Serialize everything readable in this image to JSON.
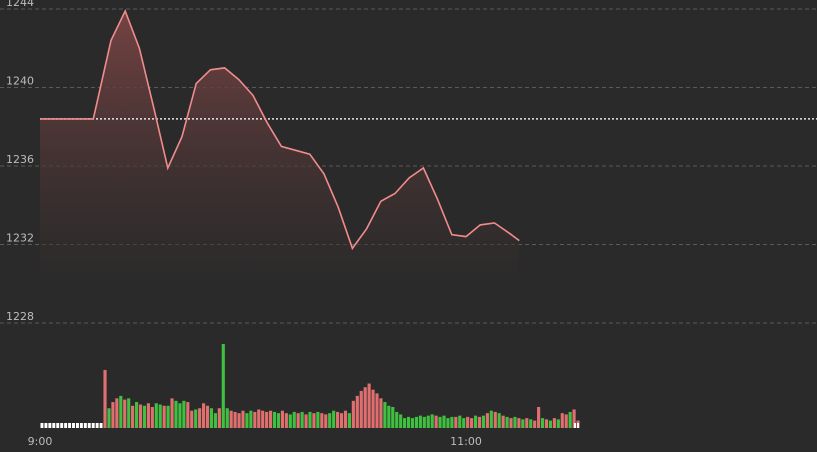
{
  "chart_data": {
    "type": "line",
    "title": "",
    "ylim": [
      1228,
      1244
    ],
    "yticks": [
      "1244",
      "1240",
      "1236",
      "1232",
      "1228"
    ],
    "xtick_labels": [
      "9:00",
      "11:00"
    ],
    "grid": true,
    "reference_line": 1238.4,
    "colors": {
      "line": "#f08c8c",
      "up": "#e07070",
      "down": "#40c040",
      "grid": "#5a5a5a",
      "reference": "#e8e8e8"
    },
    "price_series": [
      [
        "9:00",
        1238.4
      ],
      [
        "9:15",
        1238.4
      ],
      [
        "9:20",
        1242.4
      ],
      [
        "9:24",
        1243.9
      ],
      [
        "9:28",
        1242.0
      ],
      [
        "9:32",
        1239.0
      ],
      [
        "9:36",
        1235.9
      ],
      [
        "9:40",
        1237.5
      ],
      [
        "9:44",
        1240.2
      ],
      [
        "9:48",
        1240.9
      ],
      [
        "9:52",
        1241.0
      ],
      [
        "9:56",
        1240.4
      ],
      [
        "10:00",
        1239.6
      ],
      [
        "10:04",
        1238.2
      ],
      [
        "10:08",
        1237.0
      ],
      [
        "10:12",
        1236.8
      ],
      [
        "10:16",
        1236.6
      ],
      [
        "10:20",
        1235.6
      ],
      [
        "10:24",
        1233.9
      ],
      [
        "10:28",
        1231.8
      ],
      [
        "10:32",
        1232.8
      ],
      [
        "10:36",
        1234.2
      ],
      [
        "10:40",
        1234.6
      ],
      [
        "10:44",
        1235.4
      ],
      [
        "10:48",
        1235.9
      ],
      [
        "10:52",
        1234.3
      ],
      [
        "10:56",
        1232.5
      ],
      [
        "11:00",
        1232.4
      ],
      [
        "11:04",
        1233.0
      ],
      [
        "11:08",
        1233.1
      ],
      [
        "11:12",
        1232.6
      ],
      [
        "11:15",
        1232.2
      ]
    ],
    "volume_series": [
      [
        0,
        0
      ],
      [
        0,
        0
      ],
      [
        0,
        0
      ],
      [
        0,
        0
      ],
      [
        0,
        0
      ],
      [
        0,
        0
      ],
      [
        0,
        0
      ],
      [
        0,
        0
      ],
      [
        0,
        0
      ],
      [
        0,
        0
      ],
      [
        0,
        0
      ],
      [
        0,
        0
      ],
      [
        0,
        0
      ],
      [
        0,
        0
      ],
      [
        0,
        0
      ],
      [
        0,
        0
      ],
      [
        47,
        0
      ],
      [
        16,
        1
      ],
      [
        21,
        0
      ],
      [
        24,
        0
      ],
      [
        26,
        1
      ],
      [
        23,
        0
      ],
      [
        24,
        1
      ],
      [
        18,
        0
      ],
      [
        21,
        1
      ],
      [
        19,
        0
      ],
      [
        18,
        1
      ],
      [
        20,
        0
      ],
      [
        17,
        0
      ],
      [
        20,
        1
      ],
      [
        19,
        1
      ],
      [
        18,
        0
      ],
      [
        18,
        1
      ],
      [
        24,
        0
      ],
      [
        22,
        1
      ],
      [
        20,
        1
      ],
      [
        22,
        1
      ],
      [
        21,
        0
      ],
      [
        14,
        0
      ],
      [
        15,
        1
      ],
      [
        16,
        0
      ],
      [
        20,
        0
      ],
      [
        18,
        0
      ],
      [
        16,
        1
      ],
      [
        12,
        1
      ],
      [
        16,
        0
      ],
      [
        68,
        1
      ],
      [
        16,
        1
      ],
      [
        14,
        0
      ],
      [
        13,
        0
      ],
      [
        12,
        0
      ],
      [
        14,
        0
      ],
      [
        12,
        1
      ],
      [
        14,
        1
      ],
      [
        13,
        0
      ],
      [
        15,
        0
      ],
      [
        14,
        0
      ],
      [
        13,
        0
      ],
      [
        14,
        0
      ],
      [
        13,
        1
      ],
      [
        12,
        1
      ],
      [
        14,
        0
      ],
      [
        12,
        0
      ],
      [
        11,
        1
      ],
      [
        13,
        1
      ],
      [
        12,
        0
      ],
      [
        13,
        1
      ],
      [
        11,
        0
      ],
      [
        13,
        1
      ],
      [
        12,
        0
      ],
      [
        13,
        1
      ],
      [
        12,
        0
      ],
      [
        11,
        0
      ],
      [
        12,
        1
      ],
      [
        14,
        1
      ],
      [
        13,
        0
      ],
      [
        12,
        0
      ],
      [
        14,
        0
      ],
      [
        12,
        1
      ],
      [
        22,
        0
      ],
      [
        26,
        0
      ],
      [
        30,
        0
      ],
      [
        33,
        0
      ],
      [
        36,
        0
      ],
      [
        31,
        0
      ],
      [
        28,
        0
      ],
      [
        24,
        0
      ],
      [
        21,
        1
      ],
      [
        18,
        1
      ],
      [
        17,
        1
      ],
      [
        13,
        1
      ],
      [
        11,
        1
      ],
      [
        8,
        1
      ],
      [
        9,
        1
      ],
      [
        8,
        1
      ],
      [
        9,
        1
      ],
      [
        10,
        1
      ],
      [
        9,
        1
      ],
      [
        10,
        1
      ],
      [
        11,
        1
      ],
      [
        10,
        0
      ],
      [
        9,
        1
      ],
      [
        10,
        1
      ],
      [
        8,
        1
      ],
      [
        9,
        1
      ],
      [
        9,
        0
      ],
      [
        10,
        1
      ],
      [
        8,
        1
      ],
      [
        9,
        0
      ],
      [
        8,
        0
      ],
      [
        10,
        1
      ],
      [
        9,
        0
      ],
      [
        10,
        1
      ],
      [
        12,
        0
      ],
      [
        14,
        1
      ],
      [
        13,
        0
      ],
      [
        12,
        1
      ],
      [
        10,
        0
      ],
      [
        9,
        1
      ],
      [
        8,
        0
      ],
      [
        9,
        1
      ],
      [
        8,
        0
      ],
      [
        7,
        1
      ],
      [
        8,
        0
      ],
      [
        7,
        1
      ],
      [
        6,
        0
      ],
      [
        17,
        0
      ],
      [
        8,
        1
      ],
      [
        7,
        0
      ],
      [
        6,
        1
      ],
      [
        8,
        0
      ],
      [
        7,
        1
      ],
      [
        12,
        0
      ],
      [
        11,
        0
      ],
      [
        13,
        1
      ],
      [
        15,
        0
      ],
      [
        6,
        0
      ]
    ]
  }
}
